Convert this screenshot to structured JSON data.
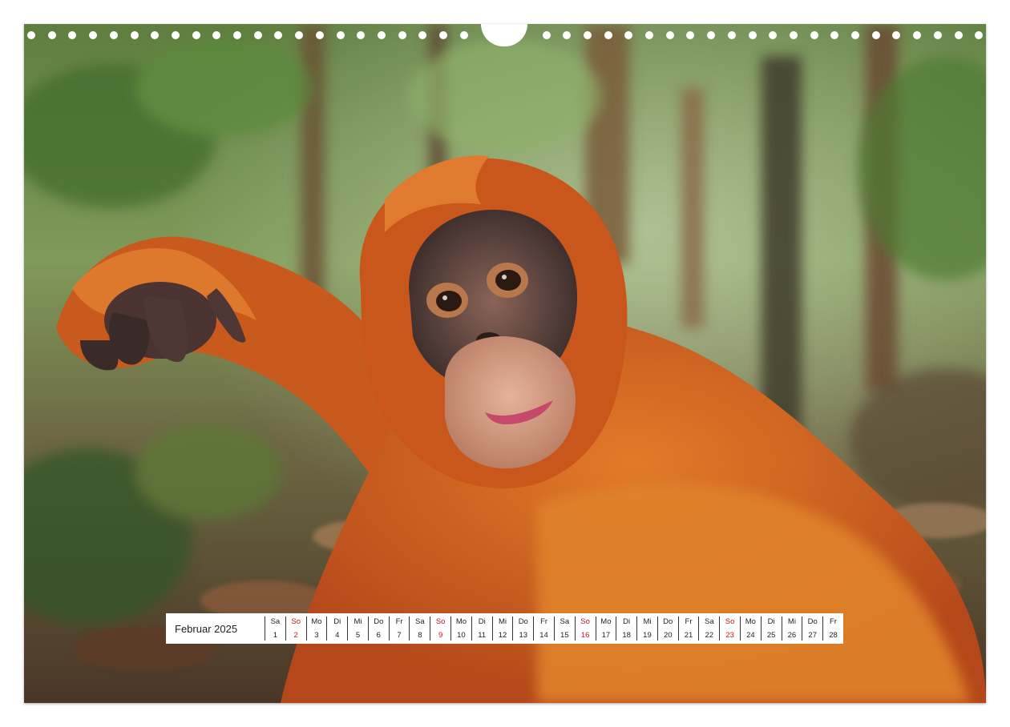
{
  "calendar": {
    "month_label": "Februar 2025",
    "days": [
      {
        "weekday": "Sa",
        "num": "1",
        "sunday": false
      },
      {
        "weekday": "So",
        "num": "2",
        "sunday": true
      },
      {
        "weekday": "Mo",
        "num": "3",
        "sunday": false
      },
      {
        "weekday": "Di",
        "num": "4",
        "sunday": false
      },
      {
        "weekday": "Mi",
        "num": "5",
        "sunday": false
      },
      {
        "weekday": "Do",
        "num": "6",
        "sunday": false
      },
      {
        "weekday": "Fr",
        "num": "7",
        "sunday": false
      },
      {
        "weekday": "Sa",
        "num": "8",
        "sunday": false
      },
      {
        "weekday": "So",
        "num": "9",
        "sunday": true
      },
      {
        "weekday": "Mo",
        "num": "10",
        "sunday": false
      },
      {
        "weekday": "Di",
        "num": "11",
        "sunday": false
      },
      {
        "weekday": "Mi",
        "num": "12",
        "sunday": false
      },
      {
        "weekday": "Do",
        "num": "13",
        "sunday": false
      },
      {
        "weekday": "Fr",
        "num": "14",
        "sunday": false
      },
      {
        "weekday": "Sa",
        "num": "15",
        "sunday": false
      },
      {
        "weekday": "So",
        "num": "16",
        "sunday": true
      },
      {
        "weekday": "Mo",
        "num": "17",
        "sunday": false
      },
      {
        "weekday": "Di",
        "num": "18",
        "sunday": false
      },
      {
        "weekday": "Mi",
        "num": "19",
        "sunday": false
      },
      {
        "weekday": "Do",
        "num": "20",
        "sunday": false
      },
      {
        "weekday": "Fr",
        "num": "21",
        "sunday": false
      },
      {
        "weekday": "Sa",
        "num": "22",
        "sunday": false
      },
      {
        "weekday": "So",
        "num": "23",
        "sunday": true
      },
      {
        "weekday": "Mo",
        "num": "24",
        "sunday": false
      },
      {
        "weekday": "Di",
        "num": "25",
        "sunday": false
      },
      {
        "weekday": "Mi",
        "num": "26",
        "sunday": false
      },
      {
        "weekday": "Do",
        "num": "27",
        "sunday": false
      },
      {
        "weekday": "Fr",
        "num": "28",
        "sunday": false
      }
    ]
  },
  "colors": {
    "sunday_red": "#c8161d",
    "fur_orange": "#d9661c",
    "forest_green": "#4f6b34",
    "forest_floor_brown": "#6a4a32"
  },
  "photo": {
    "subject_icon": "orangutan-photo"
  }
}
